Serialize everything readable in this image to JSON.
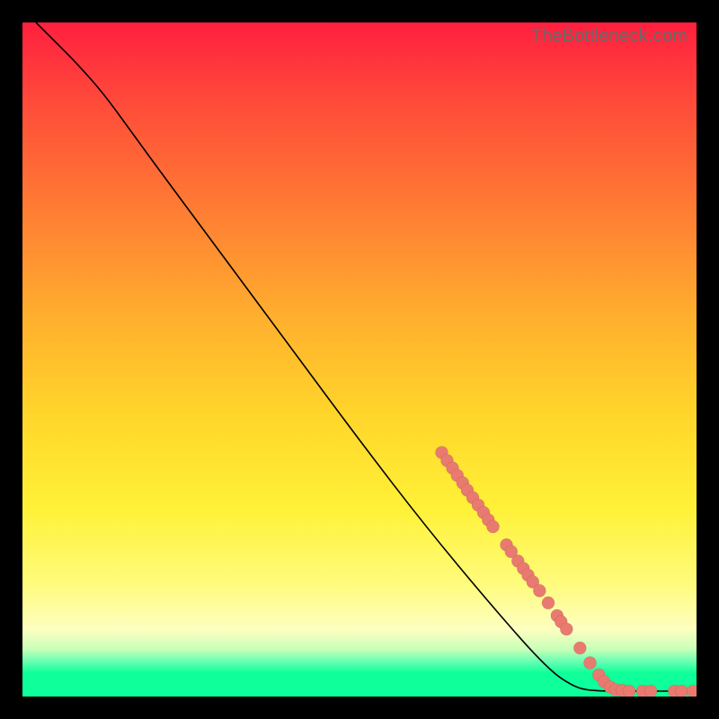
{
  "watermark": "TheBottleneck.com",
  "colors": {
    "marker": "#e97a6f",
    "curve": "#000000"
  },
  "chart_data": {
    "type": "line",
    "title": "",
    "xlabel": "",
    "ylabel": "",
    "xlim": [
      0,
      100
    ],
    "ylim": [
      0,
      100
    ],
    "curve": [
      {
        "x": 2,
        "y": 100
      },
      {
        "x": 3,
        "y": 99
      },
      {
        "x": 5,
        "y": 97
      },
      {
        "x": 8,
        "y": 94
      },
      {
        "x": 12,
        "y": 89.5
      },
      {
        "x": 16,
        "y": 84
      },
      {
        "x": 20,
        "y": 78.5
      },
      {
        "x": 30,
        "y": 65
      },
      {
        "x": 40,
        "y": 51.5
      },
      {
        "x": 50,
        "y": 38
      },
      {
        "x": 60,
        "y": 25
      },
      {
        "x": 70,
        "y": 13
      },
      {
        "x": 78,
        "y": 4
      },
      {
        "x": 82,
        "y": 1.3
      },
      {
        "x": 85,
        "y": 0.8
      },
      {
        "x": 90,
        "y": 0.8
      },
      {
        "x": 100,
        "y": 0.8
      }
    ],
    "markers": [
      {
        "x": 62.2,
        "y": 36.2
      },
      {
        "x": 63.0,
        "y": 35.0
      },
      {
        "x": 63.8,
        "y": 33.9
      },
      {
        "x": 64.5,
        "y": 32.8
      },
      {
        "x": 65.3,
        "y": 31.7
      },
      {
        "x": 66.0,
        "y": 30.6
      },
      {
        "x": 66.8,
        "y": 29.5
      },
      {
        "x": 67.6,
        "y": 28.4
      },
      {
        "x": 68.4,
        "y": 27.3
      },
      {
        "x": 69.1,
        "y": 26.2
      },
      {
        "x": 69.8,
        "y": 25.2
      },
      {
        "x": 71.8,
        "y": 22.5
      },
      {
        "x": 72.5,
        "y": 21.5
      },
      {
        "x": 73.5,
        "y": 20.1
      },
      {
        "x": 74.3,
        "y": 19.0
      },
      {
        "x": 75.0,
        "y": 18.0
      },
      {
        "x": 75.7,
        "y": 17.0
      },
      {
        "x": 76.7,
        "y": 15.7
      },
      {
        "x": 78.0,
        "y": 13.9
      },
      {
        "x": 79.3,
        "y": 12.0
      },
      {
        "x": 79.9,
        "y": 11.1
      },
      {
        "x": 80.7,
        "y": 10.0
      },
      {
        "x": 82.7,
        "y": 7.2
      },
      {
        "x": 84.2,
        "y": 5.0
      },
      {
        "x": 85.5,
        "y": 3.2
      },
      {
        "x": 86.3,
        "y": 2.2
      },
      {
        "x": 87.2,
        "y": 1.4
      },
      {
        "x": 88.0,
        "y": 1.0
      },
      {
        "x": 89.0,
        "y": 0.9
      },
      {
        "x": 90.0,
        "y": 0.8
      },
      {
        "x": 92.0,
        "y": 0.8
      },
      {
        "x": 93.2,
        "y": 0.8
      },
      {
        "x": 96.7,
        "y": 0.8
      },
      {
        "x": 97.8,
        "y": 0.8
      },
      {
        "x": 99.5,
        "y": 0.8
      }
    ]
  }
}
